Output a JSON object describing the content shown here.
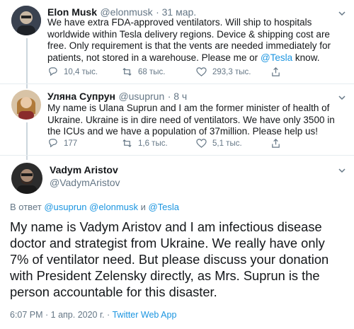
{
  "tweets": [
    {
      "name": "Elon Musk",
      "handle": "@elonmusk",
      "time": "· 31 мар.",
      "text_before": "We have extra FDA-approved ventilators. Will ship to hospitals worldwide within Tesla delivery regions. Device & shipping cost are free. Only requirement is that the vents are needed immediately for patients, not stored in a warehouse. Please me or ",
      "mention": "@Tesla",
      "text_after": " know.",
      "replies": "10,4 тыс.",
      "retweets": "68 тыс.",
      "likes": "293,3 тыс."
    },
    {
      "name": "Уляна Супрун",
      "handle": "@usuprun",
      "time": "· 8 ч",
      "text": "My name is Ulana Suprun and I am the former minister of health of Ukraine. Ukraine is in dire need of ventilators. We have only 3500 in the ICUs and we have a population of  37million. Please help us!",
      "replies": "177",
      "retweets": "1,6 тыс.",
      "likes": "5,1 тыс."
    }
  ],
  "main": {
    "name": "Vadym Aristov",
    "handle": "@VadymAristov",
    "reply_prefix": "В ответ ",
    "reply_to": [
      "@usuprun",
      "@elonmusk",
      "@Tesla"
    ],
    "reply_sep1": " ",
    "reply_sep2": " и ",
    "text": "My name is Vadym Aristov and I am infectious disease doctor and strategist from Ukraine. We really have only 7% of ventilator need. But please discuss your donation with President Zelensky directly, as Mrs. Suprun is the person accountable for this disaster.",
    "timestamp": "6:07 PM · 1 апр. 2020 г. · ",
    "source": "Twitter Web App"
  },
  "colors": {
    "accent": "#1b95e0",
    "muted": "#657786",
    "text": "#14171a",
    "border": "#e6ecf0"
  },
  "icons": [
    "reply-icon",
    "retweet-icon",
    "like-icon",
    "share-icon",
    "chevron-down-icon"
  ]
}
